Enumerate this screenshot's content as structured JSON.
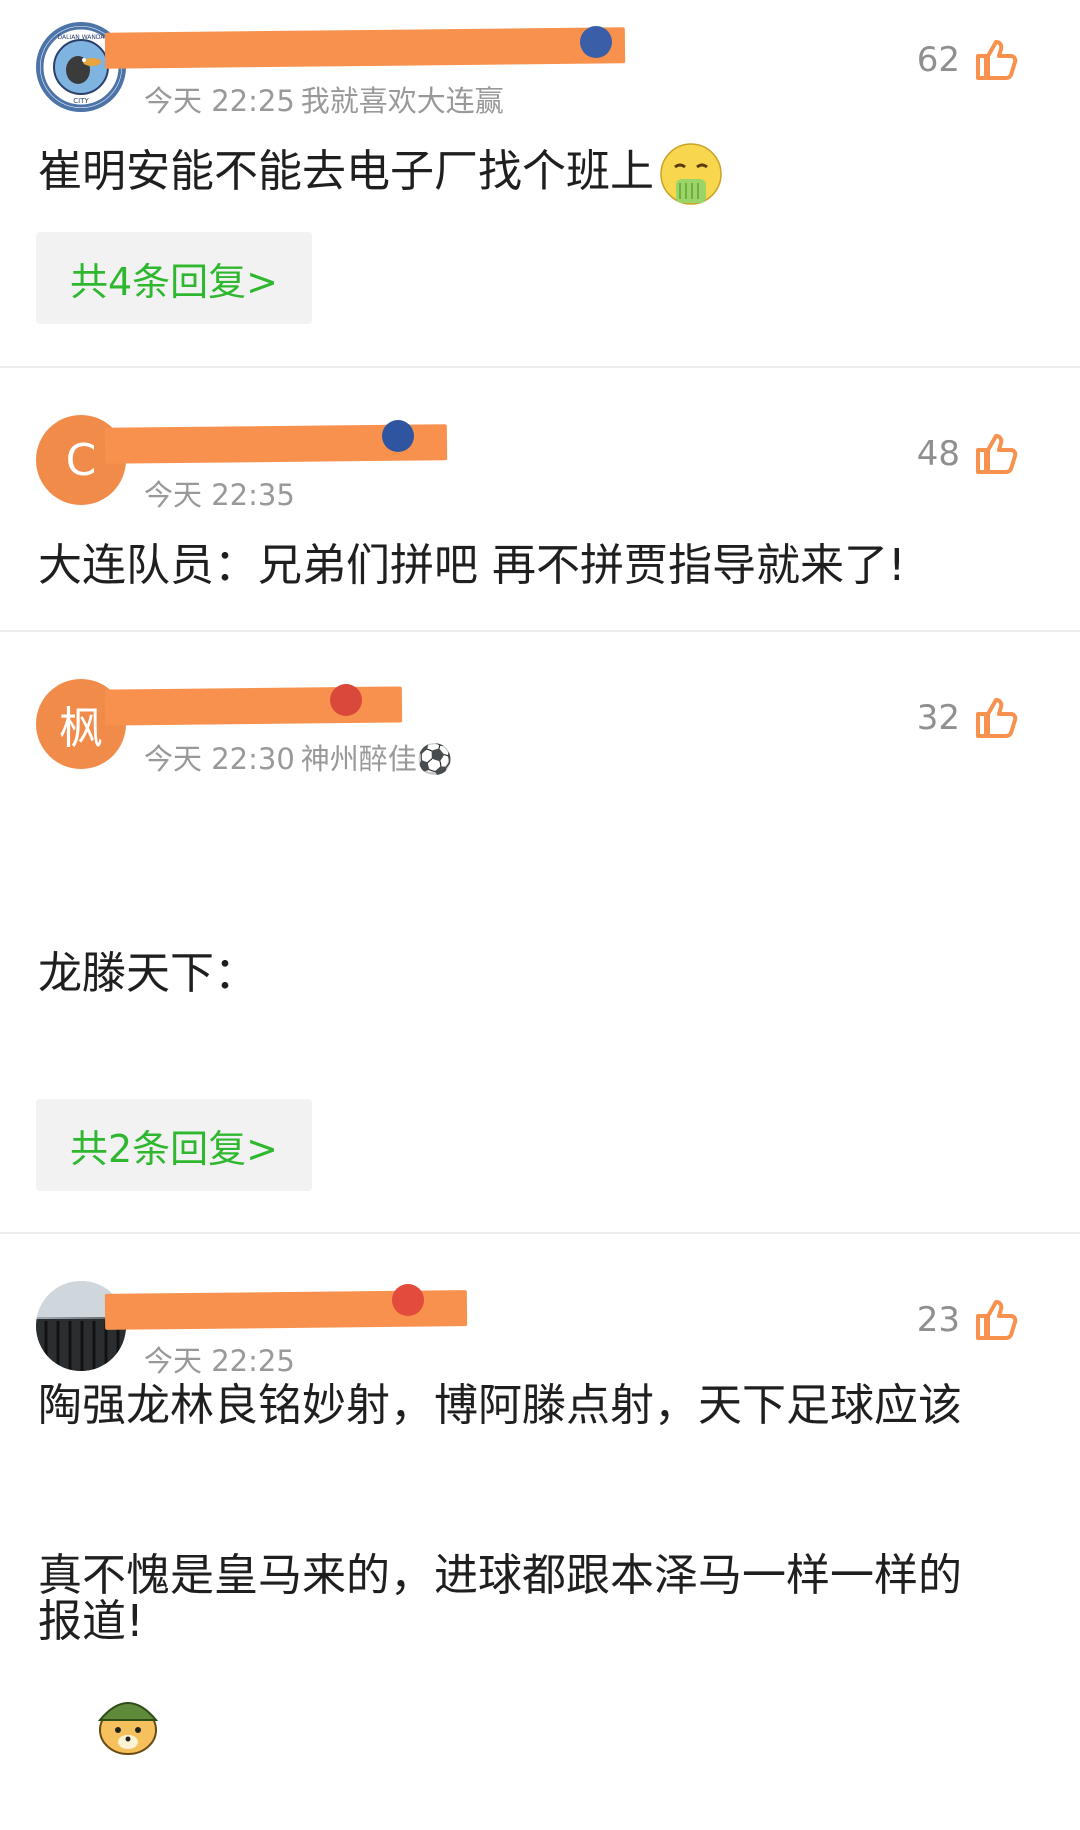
{
  "comments": [
    {
      "time": "今天 22:25",
      "signature": "我就喜欢大连赢",
      "likes": "62",
      "text": "崔明安能不能去电子厂找个班上",
      "emoji": "nauseated-face-icon",
      "replies": "共4条回复>"
    },
    {
      "avatar_letter": "C",
      "time": "今天 22:35",
      "signature": "",
      "likes": "48",
      "text": "大连队员：兄弟们拼吧 再不拼贾指导就来了!",
      "replies": ""
    },
    {
      "avatar_letter": "枫",
      "time": "今天 22:30",
      "signature": "神州醉佳⚽",
      "likes": "32",
      "text_lines": [
        "龙滕天下：",
        "",
        "陶强龙林良铭妙射，博阿滕点射，天下足球应该",
        "报道!"
      ],
      "replies": "共2条回复>"
    },
    {
      "time": "今天 22:25",
      "signature": "",
      "likes": "23",
      "text": "真不愧是皇马来的，进球都跟本泽马一样一样的",
      "emoji": "doge-helmet-icon"
    }
  ],
  "colors": {
    "accent_green": "#2fb82f",
    "like_orange": "#f7914d",
    "redaction": "#f7914d",
    "meta_gray": "#999999"
  },
  "club_logo_text": {
    "top": "DALIAN WANDA",
    "bottom": "CITY"
  }
}
